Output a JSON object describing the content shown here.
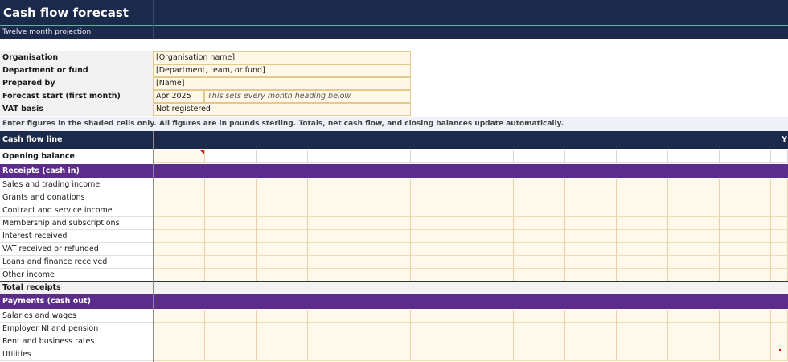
{
  "sheet": {
    "title": "Cash flow forecast",
    "subtitle": "Twelve month projection"
  },
  "details": [
    {
      "label": "Organisation",
      "value": "[Organisation name]"
    },
    {
      "label": "Department or fund",
      "value": "[Department, team, or fund]"
    },
    {
      "label": "Prepared by",
      "value": "[Name]"
    },
    {
      "label": "Forecast start (first month)",
      "value": "Apr 2025",
      "note": "This sets every month heading below."
    },
    {
      "label": "VAT basis",
      "value": "Not registered"
    }
  ],
  "instructions": "Enter figures in the shaded cells only. All figures are in pounds sterling. Totals, net cash flow, and closing balances update automatically.",
  "table_header": {
    "label": "Cash flow line",
    "right_label": "Y"
  },
  "opening_balance": "Opening balance",
  "receipts": {
    "section": "Receipts  (cash in)",
    "lines": [
      "Sales and trading income",
      "Grants and donations",
      "Contract and service income",
      "Membership and subscriptions",
      "Interest received",
      "VAT received or refunded",
      "Loans and finance received",
      "Other income"
    ],
    "total": "Total receipts"
  },
  "payments": {
    "section": "Payments  (cash out)",
    "lines": [
      "Salaries and wages",
      "Employer NI and pension",
      "Rent and business rates",
      "Utilities"
    ]
  }
}
